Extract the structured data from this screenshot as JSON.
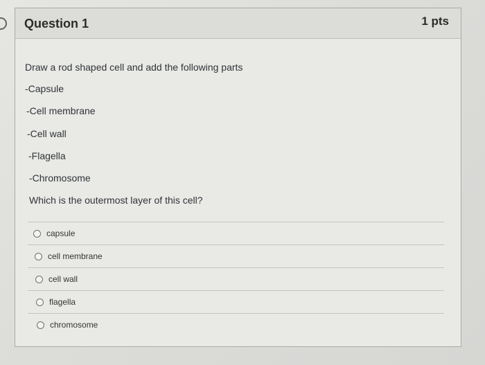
{
  "question": {
    "title": "Question 1",
    "points": "1 pts",
    "prompt_lines": [
      "Draw a rod shaped cell and add the following parts",
      "-Capsule",
      "-Cell membrane",
      "-Cell wall",
      "-Flagella",
      "-Chromosome",
      "Which is the outermost layer of this cell?"
    ],
    "answers": [
      "capsule",
      "cell membrane",
      "cell wall",
      "flagella",
      "chromosome"
    ]
  }
}
